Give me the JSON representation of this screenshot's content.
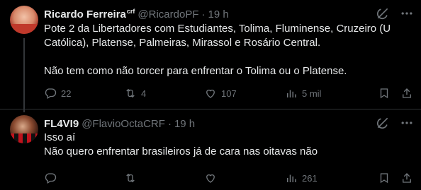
{
  "tweets": [
    {
      "author_name": "Ricardo Ferreira",
      "affiliation": "crf",
      "handle": "@RicardoPF",
      "separator": "·",
      "time": "19 h",
      "lines": [
        "Pote 2 da Libertadores com Estudiantes, Tolima, Fluminense, Cruzeiro (U",
        "Católica), Platense, Palmeiras, Mirassol e Rosário Central.",
        "",
        "Não tem como não torcer para enfrentar o Tolima ou o Platense."
      ],
      "replies": "22",
      "reposts": "4",
      "likes": "107",
      "views": "5 mil"
    },
    {
      "author_name": "FL4VI9",
      "handle": "@FlavioOctaCRF",
      "separator": "·",
      "time": "19 h",
      "lines": [
        "Isso aí",
        "Não quero enfrentar brasileiros já de cara nas oitavas não"
      ],
      "replies": "",
      "reposts": "",
      "likes": "",
      "views": "261"
    }
  ],
  "icons": {
    "grok": "grok-icon",
    "more": "more-icon",
    "reply": "reply-icon",
    "repost": "repost-icon",
    "like": "like-icon",
    "views": "views-icon",
    "bookmark": "bookmark-icon",
    "share": "share-icon"
  },
  "colors": {
    "background": "#000000",
    "text": "#e7e9ea",
    "muted": "#71767b",
    "divider": "#2f3336"
  }
}
